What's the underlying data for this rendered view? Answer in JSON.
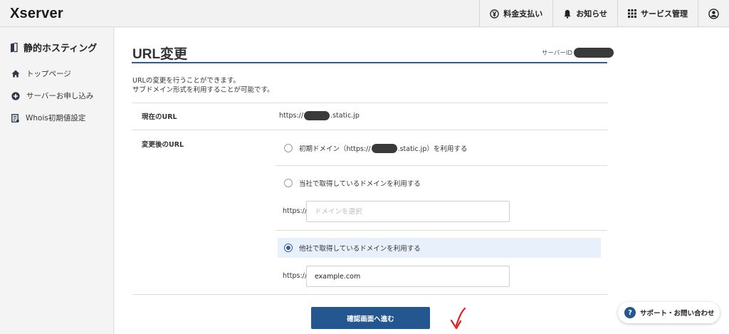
{
  "header": {
    "logo": "Xserver",
    "nav": [
      {
        "label": "料金支払い",
        "icon": "yen-icon"
      },
      {
        "label": "お知らせ",
        "icon": "bell-icon"
      },
      {
        "label": "サービス管理",
        "icon": "grid-icon"
      }
    ],
    "user_icon": "user-icon"
  },
  "sidebar": {
    "title": "静的ホスティング",
    "title_icon": "book-icon",
    "items": [
      {
        "label": "トップページ",
        "icon": "home-icon"
      },
      {
        "label": "サーバーお申し込み",
        "icon": "plus-circle-icon"
      },
      {
        "label": "Whois初期値設定",
        "icon": "document-icon"
      }
    ]
  },
  "main": {
    "title": "URL変更",
    "server_id_label": "サーバーID",
    "description": [
      "URLの変更を行うことができます。",
      "サブドメイン形式を利用することが可能です。"
    ],
    "current_url": {
      "label": "現在のURL",
      "prefix": "https://",
      "suffix": ".static.jp"
    },
    "new_url": {
      "label": "変更後のURL",
      "options": [
        {
          "prefix": "初期ドメイン（https://",
          "suffix": ".static.jp）を利用する",
          "selected": false
        },
        {
          "label": "当社で取得しているドメインを利用する",
          "selected": false
        },
        {
          "label": "他社で取得しているドメインを利用する",
          "selected": true
        }
      ],
      "own_domain_input": {
        "prefix": "https://",
        "placeholder": "ドメインを選択",
        "value": ""
      },
      "other_domain_input": {
        "prefix": "https://",
        "placeholder": "",
        "value": "example.com"
      }
    },
    "submit_label": "確認画面へ進む"
  },
  "support": {
    "label": "サポート・お問い合わせ",
    "icon_glyph": "?"
  },
  "colors": {
    "accent": "#24578f",
    "selected_bg": "#e8f1fb",
    "annotation_arrow": "#e02020"
  }
}
